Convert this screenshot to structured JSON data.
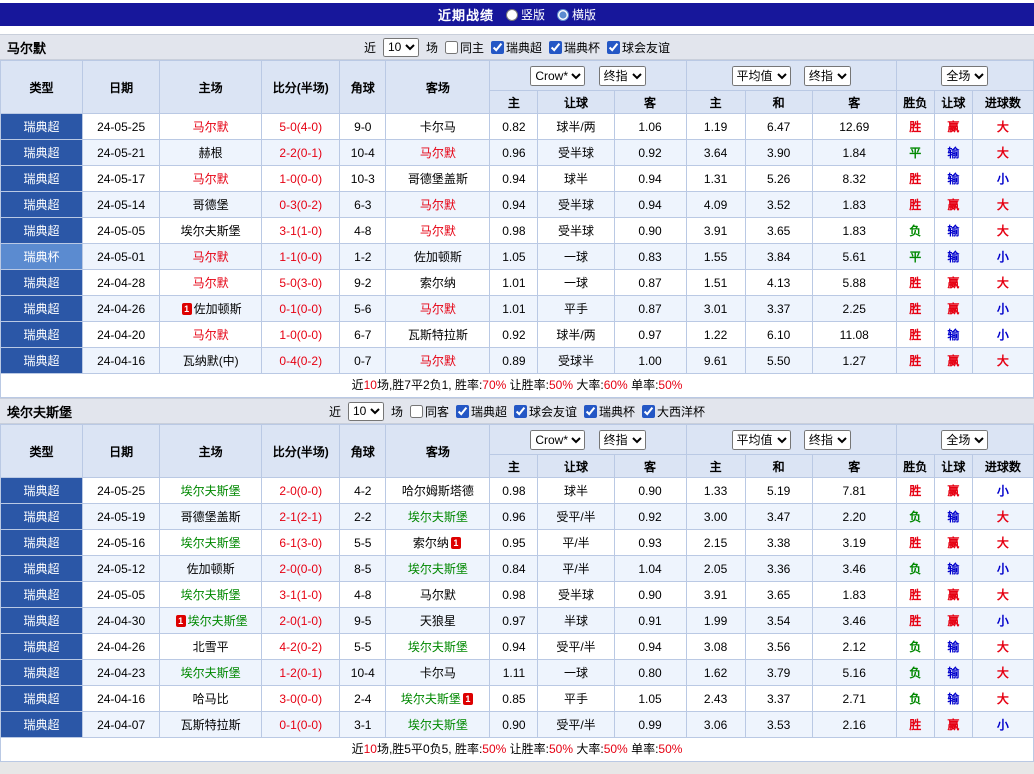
{
  "topbar": {
    "title": "近期战绩",
    "layout_options": [
      {
        "label": "竖版",
        "selected": false
      },
      {
        "label": "横版",
        "selected": true
      }
    ]
  },
  "labels": {
    "near": "近",
    "games": "场"
  },
  "selects": {
    "count": "10",
    "company": "Crow*",
    "final": "终指",
    "average": "平均值",
    "scope": "全场"
  },
  "columns": {
    "main": [
      "类型",
      "日期",
      "主场",
      "比分(半场)",
      "角球",
      "客场"
    ],
    "sub": [
      "主",
      "让球",
      "客",
      "主",
      "和",
      "客",
      "胜负",
      "让球",
      "进球数"
    ]
  },
  "colors": {
    "red": "#e60012",
    "blue": "#0000cc",
    "green": "#008800",
    "league_super": "#2b57a7",
    "league_cup": "#5b8bd0",
    "topbar_bg": "#17179b"
  },
  "card_text": "1",
  "sections": [
    {
      "team": "马尔默",
      "team_color": "#e60012",
      "filter": {
        "same_label": "同主",
        "leagues": [
          "瑞典超",
          "瑞典杯",
          "球会友谊"
        ]
      },
      "rows": [
        {
          "league": "瑞典超",
          "date": "24-05-25",
          "home": {
            "name": "马尔默",
            "self": true
          },
          "score": "5-0(4-0)",
          "corner": "9-0",
          "away": {
            "name": "卡尔马"
          },
          "asian": [
            "0.82",
            "球半/两",
            "1.06"
          ],
          "euro": [
            "1.19",
            "6.47",
            "12.69"
          ],
          "results": [
            "胜",
            "赢",
            "大"
          ]
        },
        {
          "league": "瑞典超",
          "date": "24-05-21",
          "home": {
            "name": "赫根"
          },
          "score": "2-2(0-1)",
          "corner": "10-4",
          "away": {
            "name": "马尔默",
            "self": true
          },
          "asian": [
            "0.96",
            "受半球",
            "0.92"
          ],
          "euro": [
            "3.64",
            "3.90",
            "1.84"
          ],
          "results": [
            "平",
            "输",
            "大"
          ]
        },
        {
          "league": "瑞典超",
          "date": "24-05-17",
          "home": {
            "name": "马尔默",
            "self": true
          },
          "score": "1-0(0-0)",
          "corner": "10-3",
          "away": {
            "name": "哥德堡盖斯"
          },
          "asian": [
            "0.94",
            "球半",
            "0.94"
          ],
          "euro": [
            "1.31",
            "5.26",
            "8.32"
          ],
          "results": [
            "胜",
            "输",
            "小"
          ]
        },
        {
          "league": "瑞典超",
          "date": "24-05-14",
          "home": {
            "name": "哥德堡"
          },
          "score": "0-3(0-2)",
          "corner": "6-3",
          "away": {
            "name": "马尔默",
            "self": true
          },
          "asian": [
            "0.94",
            "受半球",
            "0.94"
          ],
          "euro": [
            "4.09",
            "3.52",
            "1.83"
          ],
          "results": [
            "胜",
            "赢",
            "大"
          ]
        },
        {
          "league": "瑞典超",
          "date": "24-05-05",
          "home": {
            "name": "埃尔夫斯堡"
          },
          "score": "3-1(1-0)",
          "corner": "4-8",
          "away": {
            "name": "马尔默",
            "self": true
          },
          "asian": [
            "0.98",
            "受半球",
            "0.90"
          ],
          "euro": [
            "3.91",
            "3.65",
            "1.83"
          ],
          "results": [
            "负",
            "输",
            "大"
          ]
        },
        {
          "league": "瑞典杯",
          "date": "24-05-01",
          "home": {
            "name": "马尔默",
            "self": true
          },
          "score": "1-1(0-0)",
          "corner": "1-2",
          "away": {
            "name": "佐加顿斯"
          },
          "asian": [
            "1.05",
            "一球",
            "0.83"
          ],
          "euro": [
            "1.55",
            "3.84",
            "5.61"
          ],
          "results": [
            "平",
            "输",
            "小"
          ]
        },
        {
          "league": "瑞典超",
          "date": "24-04-28",
          "home": {
            "name": "马尔默",
            "self": true
          },
          "score": "5-0(3-0)",
          "corner": "9-2",
          "away": {
            "name": "索尔纳"
          },
          "asian": [
            "1.01",
            "一球",
            "0.87"
          ],
          "euro": [
            "1.51",
            "4.13",
            "5.88"
          ],
          "results": [
            "胜",
            "赢",
            "大"
          ]
        },
        {
          "league": "瑞典超",
          "date": "24-04-26",
          "home": {
            "name": "佐加顿斯",
            "card": "before"
          },
          "score": "0-1(0-0)",
          "corner": "5-6",
          "away": {
            "name": "马尔默",
            "self": true
          },
          "asian": [
            "1.01",
            "平手",
            "0.87"
          ],
          "euro": [
            "3.01",
            "3.37",
            "2.25"
          ],
          "results": [
            "胜",
            "赢",
            "小"
          ]
        },
        {
          "league": "瑞典超",
          "date": "24-04-20",
          "home": {
            "name": "马尔默",
            "self": true
          },
          "score": "1-0(0-0)",
          "corner": "6-7",
          "away": {
            "name": "瓦斯特拉斯"
          },
          "asian": [
            "0.92",
            "球半/两",
            "0.97"
          ],
          "euro": [
            "1.22",
            "6.10",
            "11.08"
          ],
          "results": [
            "胜",
            "输",
            "小"
          ]
        },
        {
          "league": "瑞典超",
          "date": "24-04-16",
          "home": {
            "name": "瓦纳默(中)"
          },
          "score": "0-4(0-2)",
          "corner": "0-7",
          "away": {
            "name": "马尔默",
            "self": true
          },
          "asian": [
            "0.89",
            "受球半",
            "1.00"
          ],
          "euro": [
            "9.61",
            "5.50",
            "1.27"
          ],
          "results": [
            "胜",
            "赢",
            "大"
          ]
        }
      ],
      "summary": {
        "t1": "近",
        "count": "10",
        "t2": "场,胜7平2负1, 胜率:",
        "win_rate": "70%",
        "t3": " 让胜率:",
        "handicap_rate": "50%",
        "t4": " 大率:",
        "big_rate": "60%",
        "t5": " 单率:",
        "single_rate": "50%"
      }
    },
    {
      "team": "埃尔夫斯堡",
      "team_color": "#008800",
      "filter": {
        "same_label": "同客",
        "leagues": [
          "瑞典超",
          "球会友谊",
          "瑞典杯",
          "大西洋杯"
        ]
      },
      "rows": [
        {
          "league": "瑞典超",
          "date": "24-05-25",
          "home": {
            "name": "埃尔夫斯堡",
            "self": true
          },
          "score": "2-0(0-0)",
          "corner": "4-2",
          "away": {
            "name": "哈尔姆斯塔德"
          },
          "asian": [
            "0.98",
            "球半",
            "0.90"
          ],
          "euro": [
            "1.33",
            "5.19",
            "7.81"
          ],
          "results": [
            "胜",
            "赢",
            "小"
          ]
        },
        {
          "league": "瑞典超",
          "date": "24-05-19",
          "home": {
            "name": "哥德堡盖斯"
          },
          "score": "2-1(2-1)",
          "corner": "2-2",
          "away": {
            "name": "埃尔夫斯堡",
            "self": true
          },
          "asian": [
            "0.96",
            "受平/半",
            "0.92"
          ],
          "euro": [
            "3.00",
            "3.47",
            "2.20"
          ],
          "results": [
            "负",
            "输",
            "大"
          ]
        },
        {
          "league": "瑞典超",
          "date": "24-05-16",
          "home": {
            "name": "埃尔夫斯堡",
            "self": true
          },
          "score": "6-1(3-0)",
          "corner": "5-5",
          "away": {
            "name": "索尔纳",
            "card": "after"
          },
          "asian": [
            "0.95",
            "平/半",
            "0.93"
          ],
          "euro": [
            "2.15",
            "3.38",
            "3.19"
          ],
          "results": [
            "胜",
            "赢",
            "大"
          ]
        },
        {
          "league": "瑞典超",
          "date": "24-05-12",
          "home": {
            "name": "佐加顿斯"
          },
          "score": "2-0(0-0)",
          "corner": "8-5",
          "away": {
            "name": "埃尔夫斯堡",
            "self": true
          },
          "asian": [
            "0.84",
            "平/半",
            "1.04"
          ],
          "euro": [
            "2.05",
            "3.36",
            "3.46"
          ],
          "results": [
            "负",
            "输",
            "小"
          ]
        },
        {
          "league": "瑞典超",
          "date": "24-05-05",
          "home": {
            "name": "埃尔夫斯堡",
            "self": true
          },
          "score": "3-1(1-0)",
          "corner": "4-8",
          "away": {
            "name": "马尔默"
          },
          "asian": [
            "0.98",
            "受半球",
            "0.90"
          ],
          "euro": [
            "3.91",
            "3.65",
            "1.83"
          ],
          "results": [
            "胜",
            "赢",
            "大"
          ]
        },
        {
          "league": "瑞典超",
          "date": "24-04-30",
          "home": {
            "name": "埃尔夫斯堡",
            "self": true,
            "card": "before"
          },
          "score": "2-0(1-0)",
          "corner": "9-5",
          "away": {
            "name": "天狼星"
          },
          "asian": [
            "0.97",
            "半球",
            "0.91"
          ],
          "euro": [
            "1.99",
            "3.54",
            "3.46"
          ],
          "results": [
            "胜",
            "赢",
            "小"
          ]
        },
        {
          "league": "瑞典超",
          "date": "24-04-26",
          "home": {
            "name": "北雪平"
          },
          "score": "4-2(0-2)",
          "corner": "5-5",
          "away": {
            "name": "埃尔夫斯堡",
            "self": true
          },
          "asian": [
            "0.94",
            "受平/半",
            "0.94"
          ],
          "euro": [
            "3.08",
            "3.56",
            "2.12"
          ],
          "results": [
            "负",
            "输",
            "大"
          ]
        },
        {
          "league": "瑞典超",
          "date": "24-04-23",
          "home": {
            "name": "埃尔夫斯堡",
            "self": true
          },
          "score": "1-2(0-1)",
          "corner": "10-4",
          "away": {
            "name": "卡尔马"
          },
          "asian": [
            "1.11",
            "一球",
            "0.80"
          ],
          "euro": [
            "1.62",
            "3.79",
            "5.16"
          ],
          "results": [
            "负",
            "输",
            "大"
          ]
        },
        {
          "league": "瑞典超",
          "date": "24-04-16",
          "home": {
            "name": "哈马比"
          },
          "score": "3-0(0-0)",
          "corner": "2-4",
          "away": {
            "name": "埃尔夫斯堡",
            "self": true,
            "card": "after"
          },
          "asian": [
            "0.85",
            "平手",
            "1.05"
          ],
          "euro": [
            "2.43",
            "3.37",
            "2.71"
          ],
          "results": [
            "负",
            "输",
            "大"
          ]
        },
        {
          "league": "瑞典超",
          "date": "24-04-07",
          "home": {
            "name": "瓦斯特拉斯"
          },
          "score": "0-1(0-0)",
          "corner": "3-1",
          "away": {
            "name": "埃尔夫斯堡",
            "self": true
          },
          "asian": [
            "0.90",
            "受平/半",
            "0.99"
          ],
          "euro": [
            "3.06",
            "3.53",
            "2.16"
          ],
          "results": [
            "胜",
            "赢",
            "小"
          ]
        }
      ],
      "summary": {
        "t1": "近",
        "count": "10",
        "t2": "场,胜5平0负5, 胜率:",
        "win_rate": "50%",
        "t3": " 让胜率:",
        "handicap_rate": "50%",
        "t4": " 大率:",
        "big_rate": "50%",
        "t5": " 单率:",
        "single_rate": "50%"
      }
    }
  ]
}
